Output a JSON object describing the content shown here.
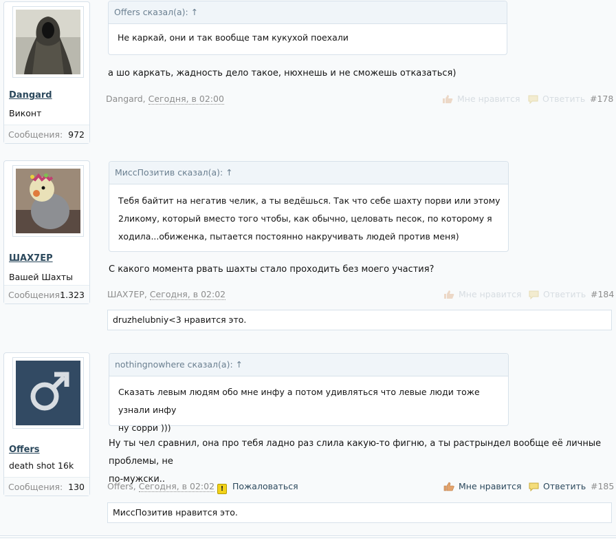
{
  "posts": [
    {
      "username": "Dangard",
      "user_title": "Виконт",
      "messages_label": "Сообщения:",
      "messages_count": "972",
      "quote_header": "Offers сказал(а): ↑",
      "quote_lines": [
        "Не каркай, они и так вообще там кукухой поехали"
      ],
      "message_lines": [
        "а шо каркать, жадность дело такое, нюхнешь и не сможешь отказаться)"
      ],
      "author": "Dangard,",
      "date": "Сегодня, в 02:00",
      "like_label": "Мне нравится",
      "reply_label": "Ответить",
      "post_number": "#178"
    },
    {
      "username": "ШАХ7ЕР",
      "user_title": "Вашей Шахты",
      "messages_label": "Сообщения:",
      "messages_count": "1.323",
      "quote_header": "МиссПозитив сказал(а): ↑",
      "quote_lines": [
        "Тебя байтит на негатив челик, а ты ведёшься. Так что себе шахту порви или этому",
        "2ликому, который вместо того чтобы, как обычно, целовать песок, по которому я",
        "ходила...обиженка, пытается постоянно накручивать людей против меня)"
      ],
      "message_lines": [
        "С какого момента рвать шахты стало проходить без моего участия?"
      ],
      "author": "ШАХ7ЕР,",
      "date": "Сегодня, в 02:02",
      "like_label": "Мне нравится",
      "reply_label": "Ответить",
      "post_number": "#184",
      "likes_text": "druzhelubniy<3 нравится это."
    },
    {
      "username": "Offers",
      "user_title": "death shot 16k",
      "messages_label": "Сообщения:",
      "messages_count": "130",
      "quote_header": "nothingnowhere сказал(а): ↑",
      "quote_lines": [
        "Сказать левым людям обо мне инфу а потом удивляться что левые люди тоже узнали инфу",
        "ну сорри )))"
      ],
      "message_lines": [
        "Ну ты чел сравнил, она про тебя ладно раз слила какую-то фигню, а ты растрындел вообще её личные проблемы, не",
        "по-мужски.."
      ],
      "author": "Offers,",
      "date": "Сегодня, в 02:02",
      "report_label": "Пожаловаться",
      "like_label": "Мне нравится",
      "reply_label": "Ответить",
      "post_number": "#185",
      "likes_text": "МиссПозитив нравится это."
    }
  ],
  "colors": {
    "link": "#2b485c",
    "muted": "#8c8c8c",
    "border": "#d7e1ea",
    "quote_bg": "#f0f5f9"
  },
  "icons": {
    "like": "thumbs-up-icon",
    "reply": "speech-bubble-icon",
    "report": "warning-icon",
    "avatar_default": "male-symbol-icon"
  }
}
